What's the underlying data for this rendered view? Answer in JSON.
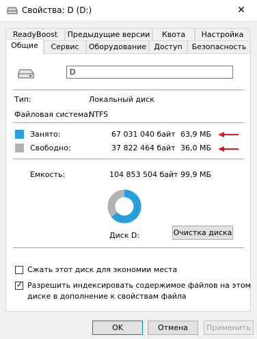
{
  "window": {
    "title": "Свойства: D (D:)"
  },
  "tabs_row1": [
    "ReadyBoost",
    "Предыдущие версии",
    "Квота",
    "Настройка"
  ],
  "tabs_row2": [
    "Общие",
    "Сервис",
    "Оборудование",
    "Доступ",
    "Безопасность"
  ],
  "general": {
    "drive_name": "D",
    "type_label": "Тип:",
    "type_value": "Локальный диск",
    "fs_label": "Файловая система:",
    "fs_value": "NTFS",
    "used_label": "Занято:",
    "used_bytes": "67 031 040 байт",
    "used_size": "63,9 МБ",
    "free_label": "Свободно:",
    "free_bytes": "37 822 464 байт",
    "free_size": "36,0 МБ",
    "capacity_label": "Емкость:",
    "capacity_bytes": "104 853 504 байт",
    "capacity_size": "99,9 МБ",
    "disk_label": "Диск D:",
    "cleanup_button": "Очистка диска",
    "compress_label": "Сжать этот диск для экономии места",
    "compress_checked": false,
    "index_label_line1": "Разрешить индексировать содержимое файлов на этом",
    "index_label_line2": "диске в дополнение к свойствам файла",
    "index_checked": true,
    "used_fraction": 0.639
  },
  "colors": {
    "used": "#26a0da",
    "free": "#b3b3b3",
    "arrow": "#e0141e",
    "accent": "#0078d7"
  },
  "buttons": {
    "ok": "OK",
    "cancel": "Отмена",
    "apply": "Применить"
  }
}
